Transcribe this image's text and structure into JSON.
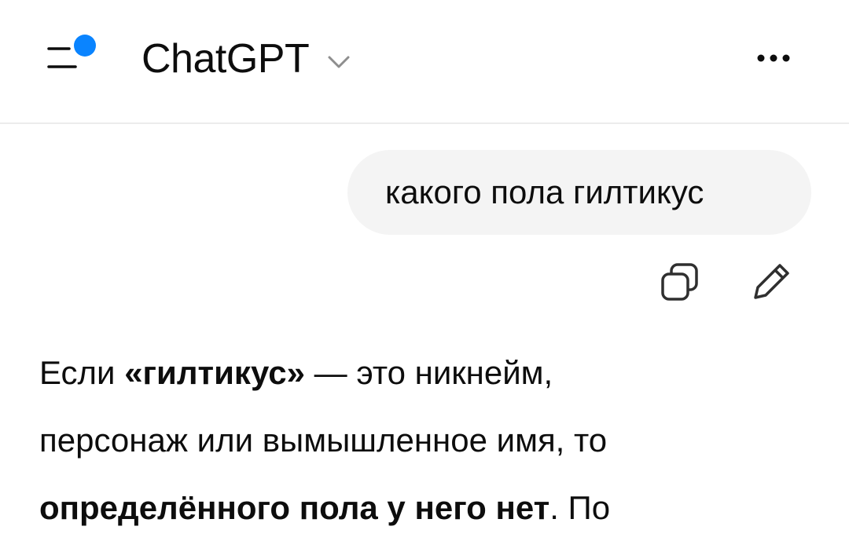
{
  "header": {
    "title": "ChatGPT",
    "notification_dot_color": "#0a84ff"
  },
  "icons": {
    "menu": "menu-with-dot-icon",
    "model_dropdown": "chevron-down-icon",
    "more": "more-horizontal-icon",
    "copy": "copy-icon",
    "edit": "pencil-icon"
  },
  "conversation": {
    "user_message": "какого пола гилтикус",
    "assistant_message": {
      "line1_prefix": "Если ",
      "line1_bold": "«гилтикус»",
      "line1_suffix": " — это никнейм,",
      "line2": "персонаж или вымышленное имя, то",
      "line3_bold": "определённого пола у него нет",
      "line3_suffix": ". По"
    }
  }
}
